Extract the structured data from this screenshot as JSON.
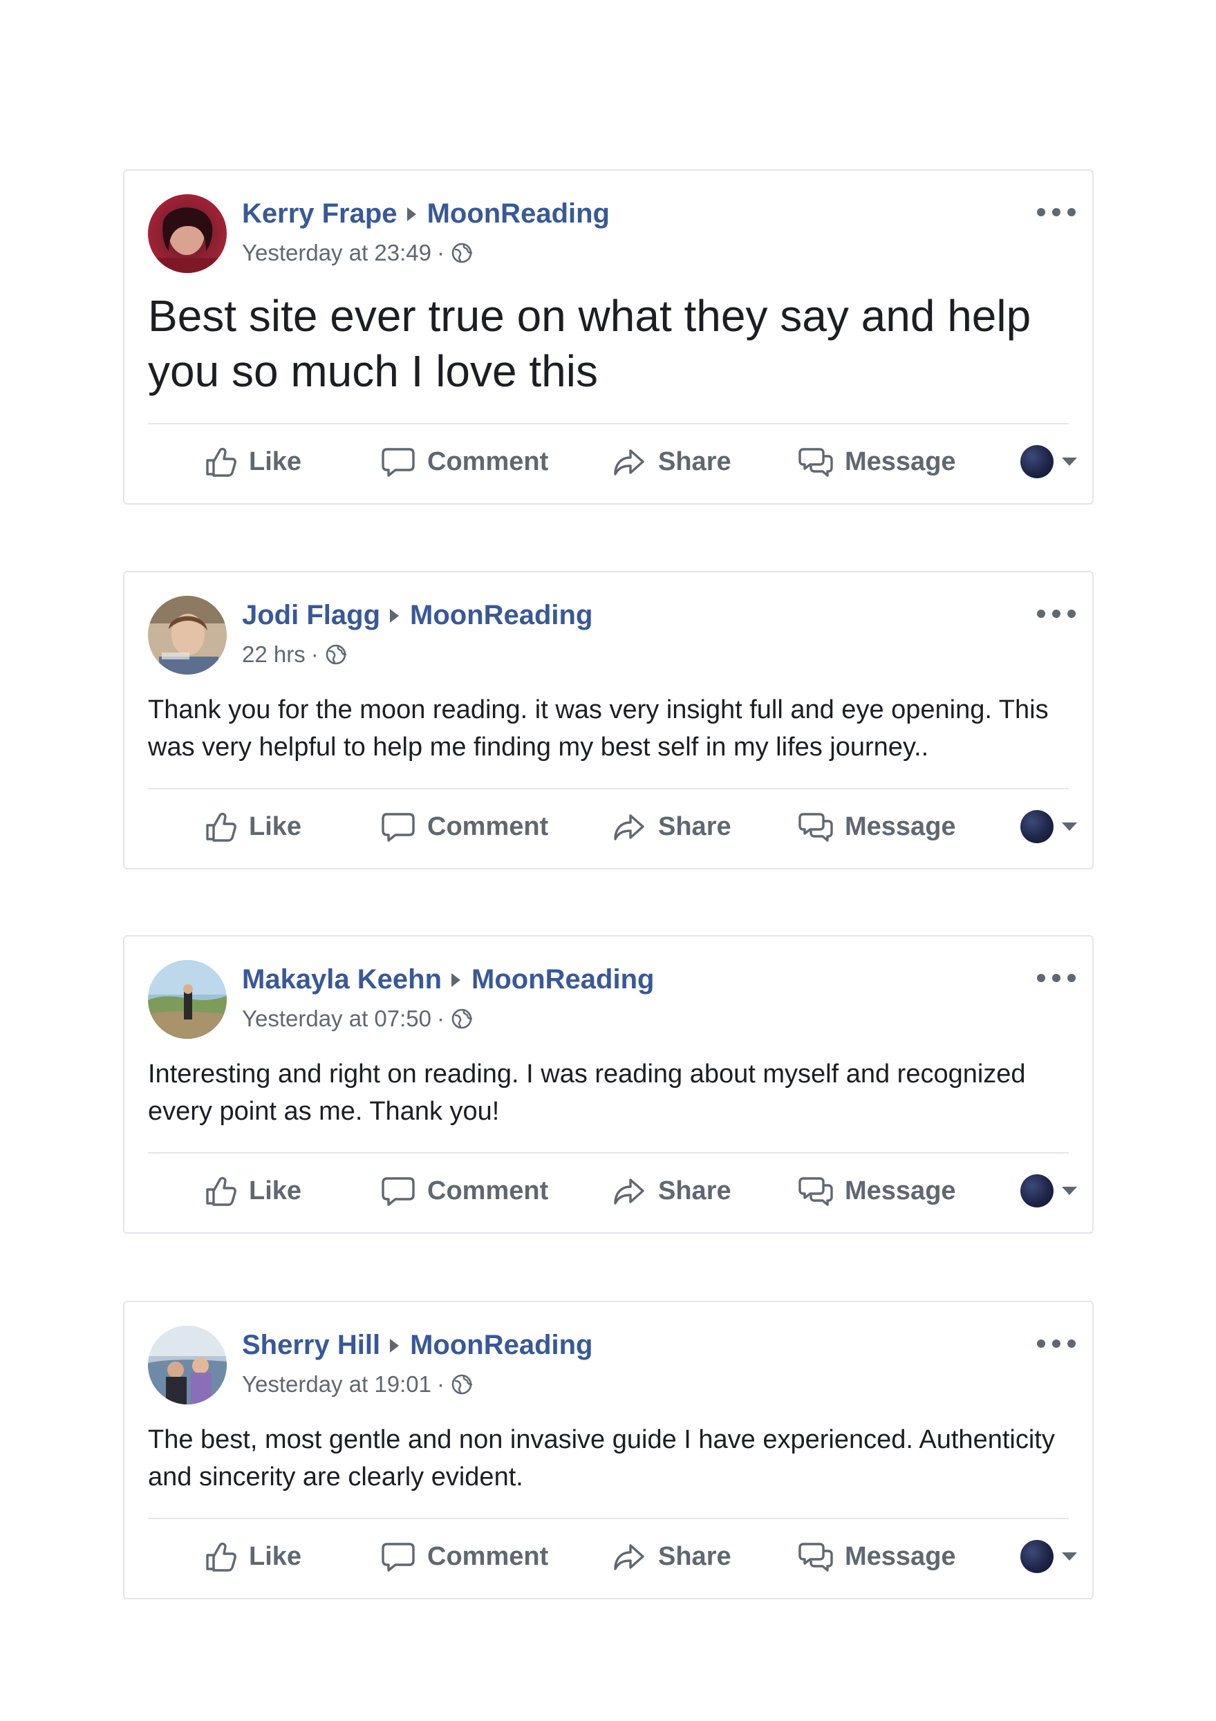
{
  "posts": [
    {
      "author": "Kerry Frape",
      "page": "MoonReading",
      "time": "Yesterday at 23:49",
      "text": "Best site ever true on what they say and help you so much I love this",
      "actions": {
        "like": "Like",
        "comment": "Comment",
        "share": "Share",
        "message": "Message"
      }
    },
    {
      "author": "Jodi Flagg",
      "page": "MoonReading",
      "time": "22 hrs",
      "text": "Thank you for the moon reading. it was very insight full and eye opening. This was very helpful to help me finding my best self in my lifes journey..",
      "actions": {
        "like": "Like",
        "comment": "Comment",
        "share": "Share",
        "message": "Message"
      }
    },
    {
      "author": "Makayla Keehn",
      "page": "MoonReading",
      "time": "Yesterday at 07:50",
      "text": "Interesting and right on reading. I was reading about myself and recognized every point as me. Thank you!",
      "actions": {
        "like": "Like",
        "comment": "Comment",
        "share": "Share",
        "message": "Message"
      }
    },
    {
      "author": "Sherry Hill",
      "page": "MoonReading",
      "time": "Yesterday at 19:01",
      "text": "The best, most gentle and non invasive guide I have experienced. Authenticity and sincerity are clearly evident.",
      "actions": {
        "like": "Like",
        "comment": "Comment",
        "share": "Share",
        "message": "Message"
      }
    }
  ],
  "meta_separator": "·",
  "icons": {
    "like": "thumbs-up-icon",
    "comment": "speech-bubble-icon",
    "share": "share-arrow-icon",
    "message": "messenger-bubbles-icon",
    "privacy": "globe-icon",
    "more": "more-dots-icon",
    "audience": "page-avatar-dropdown"
  },
  "colors": {
    "link": "#385898",
    "secondary_text": "#606770",
    "body_text": "#1c1e21",
    "border": "#e3e5e9"
  }
}
